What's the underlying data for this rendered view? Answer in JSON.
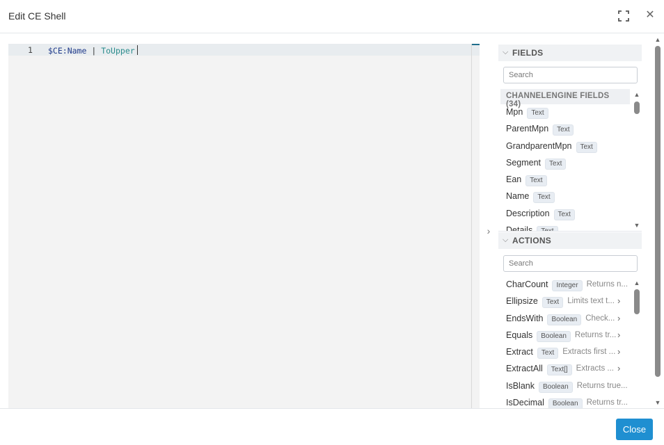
{
  "dialog": {
    "title": "Edit CE Shell"
  },
  "editor": {
    "line_number": "1",
    "tokens": {
      "var": "$CE:Name",
      "pipe": "|",
      "fn": "ToUpper"
    }
  },
  "fields": {
    "header": "FIELDS",
    "search_placeholder": "Search",
    "group": "CHANNELENGINE FIELDS (34)",
    "items": [
      {
        "name": "Mpn",
        "type": "Text"
      },
      {
        "name": "ParentMpn",
        "type": "Text"
      },
      {
        "name": "GrandparentMpn",
        "type": "Text"
      },
      {
        "name": "Segment",
        "type": "Text"
      },
      {
        "name": "Ean",
        "type": "Text"
      },
      {
        "name": "Name",
        "type": "Text"
      },
      {
        "name": "Description",
        "type": "Text"
      },
      {
        "name": "Details",
        "type": "Text"
      }
    ]
  },
  "actions": {
    "header": "ACTIONS",
    "search_placeholder": "Search",
    "items": [
      {
        "name": "CharCount",
        "type": "Integer",
        "desc": "Returns n...",
        "more": ""
      },
      {
        "name": "Ellipsize",
        "type": "Text",
        "desc": "Limits text t...",
        "more": "›"
      },
      {
        "name": "EndsWith",
        "type": "Boolean",
        "desc": "Check...",
        "more": "›"
      },
      {
        "name": "Equals",
        "type": "Boolean",
        "desc": "Returns tr...",
        "more": "›"
      },
      {
        "name": "Extract",
        "type": "Text",
        "desc": "Extracts first ...",
        "more": "›"
      },
      {
        "name": "ExtractAll",
        "type": "Text[]",
        "desc": "Extracts ...",
        "more": "›"
      },
      {
        "name": "IsBlank",
        "type": "Boolean",
        "desc": "Returns true...",
        "more": ""
      },
      {
        "name": "IsDecimal",
        "type": "Boolean",
        "desc": "Returns tr...",
        "more": ""
      }
    ]
  },
  "footer": {
    "close_label": "Close"
  },
  "colors": {
    "primary": "#1f8fd1",
    "editor_bg": "#f3f3f3",
    "line_highlight": "#e8ecef"
  }
}
